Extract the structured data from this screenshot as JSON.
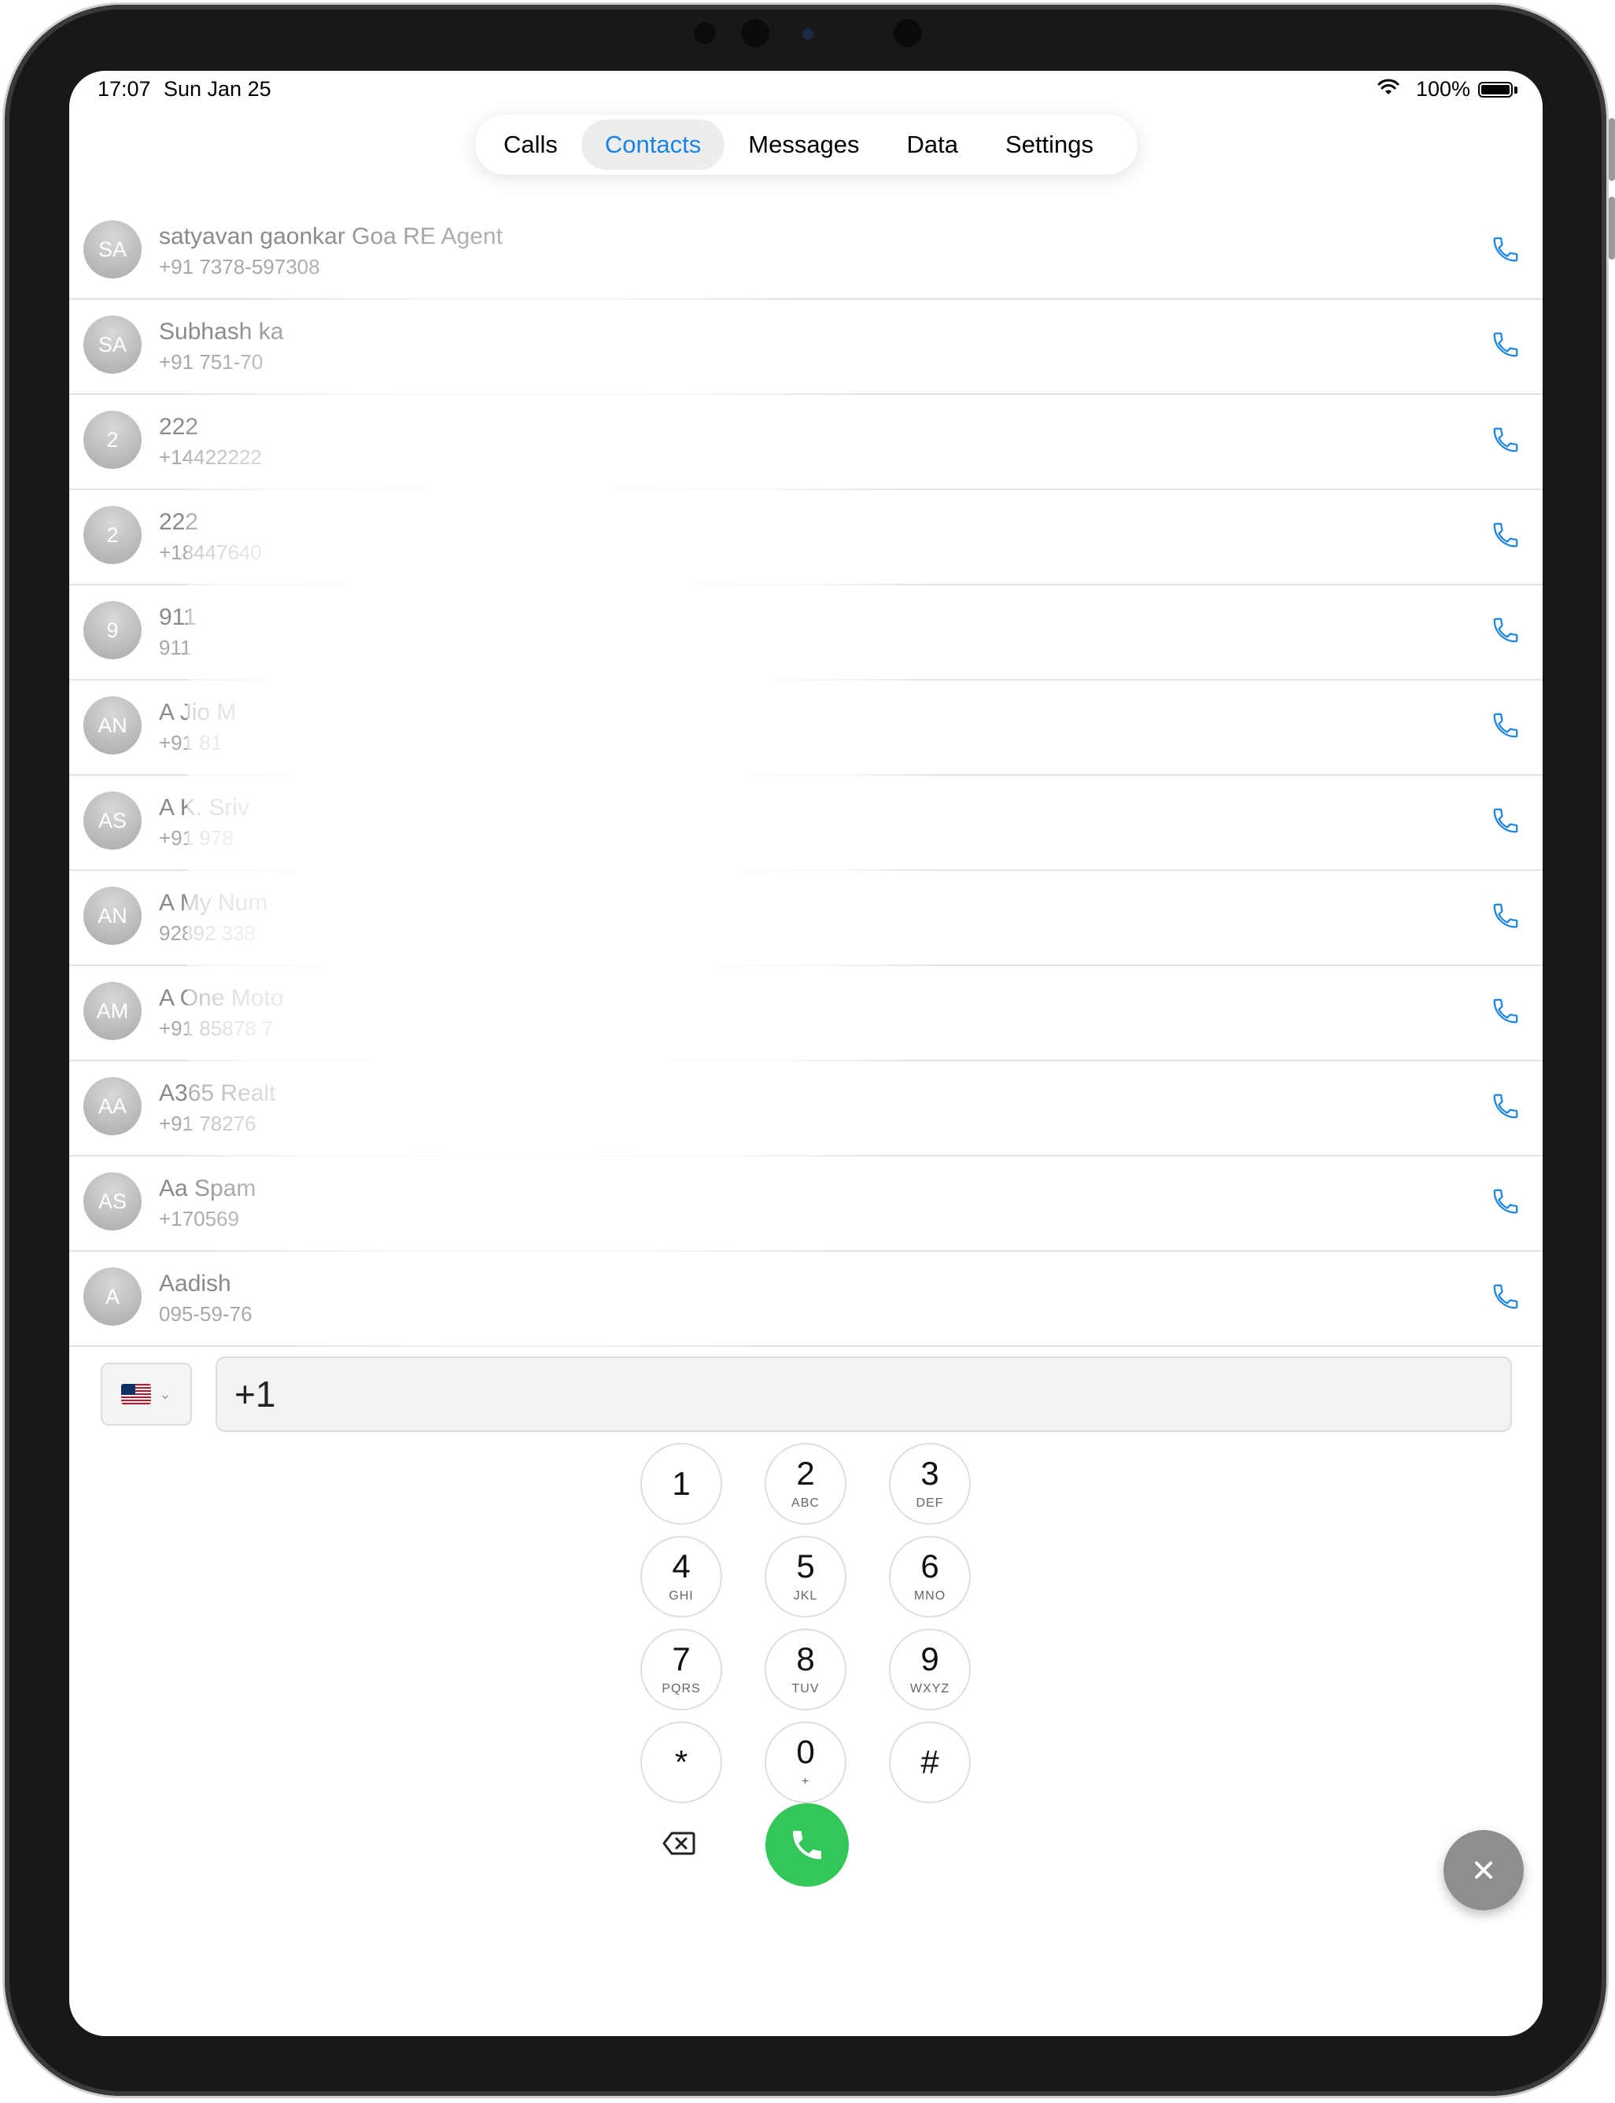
{
  "status": {
    "time": "17:07",
    "date": "Sun Jan 25",
    "battery": "100%"
  },
  "tabs": [
    {
      "label": "Calls",
      "active": false
    },
    {
      "label": "Contacts",
      "active": true
    },
    {
      "label": "Messages",
      "active": false
    },
    {
      "label": "Data",
      "active": false
    },
    {
      "label": "Settings",
      "active": false
    }
  ],
  "contacts": [
    {
      "initials": "SA",
      "name": "satyavan gaonkar Goa RE Agent",
      "number": "+91 7378-597308"
    },
    {
      "initials": "SA",
      "name": "Subhash ka",
      "number": "+91 751-70"
    },
    {
      "initials": "2",
      "name": "222",
      "number": "+14422222"
    },
    {
      "initials": "2",
      "name": "222",
      "number": "+18447640"
    },
    {
      "initials": "9",
      "name": "911",
      "number": "911"
    },
    {
      "initials": "AN",
      "name": "A Jio M",
      "number": "+91 81"
    },
    {
      "initials": "AS",
      "name": "A K. Sriv",
      "number": "+91 978"
    },
    {
      "initials": "AN",
      "name": "A My Num",
      "number": "92892 338"
    },
    {
      "initials": "AM",
      "name": "A One Moto",
      "number": "+91 85878 7"
    },
    {
      "initials": "AA",
      "name": "A365 Realt",
      "number": "+91 78276"
    },
    {
      "initials": "AS",
      "name": "Aa Spam",
      "number": "+170569"
    },
    {
      "initials": "A",
      "name": "Aadish",
      "number": "095-59-76"
    }
  ],
  "dialer": {
    "input_value": "+1",
    "country_flag": "us-flag-icon",
    "keys": [
      {
        "digit": "1",
        "letters": ""
      },
      {
        "digit": "2",
        "letters": "ABC"
      },
      {
        "digit": "3",
        "letters": "DEF"
      },
      {
        "digit": "4",
        "letters": "GHI"
      },
      {
        "digit": "5",
        "letters": "JKL"
      },
      {
        "digit": "6",
        "letters": "MNO"
      },
      {
        "digit": "7",
        "letters": "PQRS"
      },
      {
        "digit": "8",
        "letters": "TUV"
      },
      {
        "digit": "9",
        "letters": "WXYZ"
      },
      {
        "digit": "*",
        "letters": ""
      },
      {
        "digit": "0",
        "letters": "+"
      },
      {
        "digit": "#",
        "letters": ""
      }
    ]
  },
  "colors": {
    "accent": "#1a84e6",
    "call_green": "#33c759",
    "close_gray": "#8e8e8e"
  }
}
